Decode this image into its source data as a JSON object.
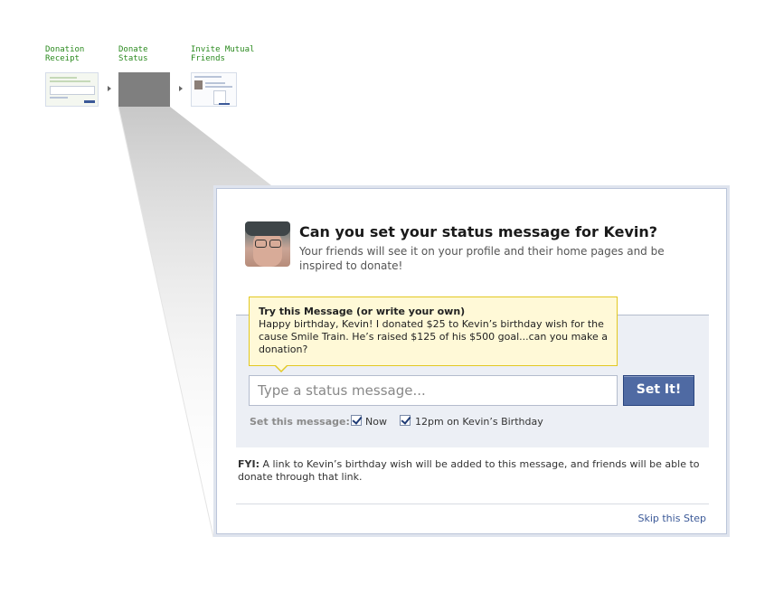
{
  "flow": {
    "steps": [
      {
        "label_line1": "Donation",
        "label_line2": "Receipt"
      },
      {
        "label_line1": "Donate",
        "label_line2": "Status"
      },
      {
        "label_line1": "Invite Mutual",
        "label_line2": "Friends"
      }
    ],
    "active_step": 2
  },
  "dialog": {
    "title": "Can you set your status message for Kevin?",
    "subtitle": "Your friends will see it on your profile and their home pages and be inspired to donate!",
    "suggestion": {
      "title": "Try this Message (or write your own)",
      "text": "Happy birthday, Kevin! I donated $25 to Kevin’s birthday wish for the cause Smile Train. He’s raised $125 of his $500 goal...can you make a donation?"
    },
    "status_input": {
      "placeholder": "Type a status message...",
      "value": ""
    },
    "set_button": "Set It!",
    "set_label": "Set this message:",
    "options": [
      {
        "label": "Now",
        "checked": true
      },
      {
        "label": "12pm on Kevin’s Birthday",
        "checked": true
      }
    ],
    "fyi_label": "FYI:",
    "fyi_text": "A link to Kevin’s birthday wish will be added to this message, and friends will be able to donate through that link.",
    "skip_link": "Skip this Step"
  },
  "colors": {
    "accent": "#3b5998",
    "button": "#4f6aa3",
    "step_label": "#2a8a1e",
    "tip_background": "#fff9d7",
    "panel_background": "#eceff5"
  },
  "icons": [
    "arrow-right-icon",
    "checkbox-icon",
    "avatar"
  ]
}
